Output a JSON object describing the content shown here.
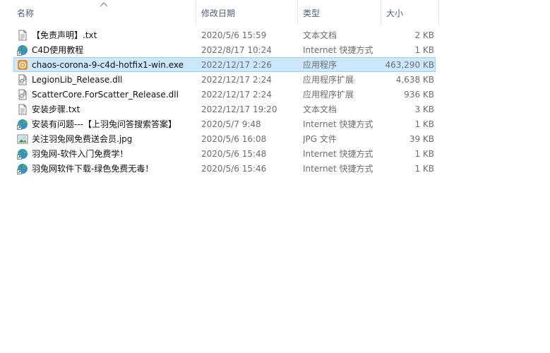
{
  "columns": {
    "name": "名称",
    "date": "修改日期",
    "type": "类型",
    "size": "大小"
  },
  "files": [
    {
      "name": "【免责声明】.txt",
      "date": "2020/5/6 15:59",
      "type": "文本文档",
      "size": "2 KB",
      "icon": "text-file-icon"
    },
    {
      "name": "C4D使用教程",
      "date": "2022/8/17 10:24",
      "type": "Internet 快捷方式",
      "size": "1 KB",
      "icon": "internet-shortcut-icon"
    },
    {
      "name": "chaos-corona-9-c4d-hotfix1-win.exe",
      "date": "2022/12/17 2:26",
      "type": "应用程序",
      "size": "463,290 KB",
      "icon": "corona-installer-icon",
      "selected": true
    },
    {
      "name": "LegionLib_Release.dll",
      "date": "2022/12/17 2:24",
      "type": "应用程序扩展",
      "size": "4,638 KB",
      "icon": "dll-file-icon"
    },
    {
      "name": "ScatterCore.ForScatter_Release.dll",
      "date": "2022/12/17 2:24",
      "type": "应用程序扩展",
      "size": "936 KB",
      "icon": "dll-file-icon"
    },
    {
      "name": "安装步骤.txt",
      "date": "2022/12/17 19:20",
      "type": "文本文档",
      "size": "3 KB",
      "icon": "text-file-icon"
    },
    {
      "name": "安装有问题---【上羽兔问答搜索答案】",
      "date": "2020/5/7 9:48",
      "type": "Internet 快捷方式",
      "size": "1 KB",
      "icon": "internet-shortcut-icon"
    },
    {
      "name": "关注羽兔网免费送会员.jpg",
      "date": "2020/5/6 16:08",
      "type": "JPG 文件",
      "size": "39 KB",
      "icon": "image-file-icon"
    },
    {
      "name": "羽兔网-软件入门免费学！",
      "date": "2020/5/6 15:48",
      "type": "Internet 快捷方式",
      "size": "1 KB",
      "icon": "internet-shortcut-icon"
    },
    {
      "name": "羽兔网软件下载-绿色免费无毒！",
      "date": "2020/5/6 15:46",
      "type": "Internet 快捷方式",
      "size": "1 KB",
      "icon": "internet-shortcut-icon"
    }
  ],
  "colors": {
    "selection_bg": "#cce8ff",
    "selection_border": "#99d1ff",
    "header_text": "#4c607a",
    "secondary_text": "#6d6d6d"
  }
}
